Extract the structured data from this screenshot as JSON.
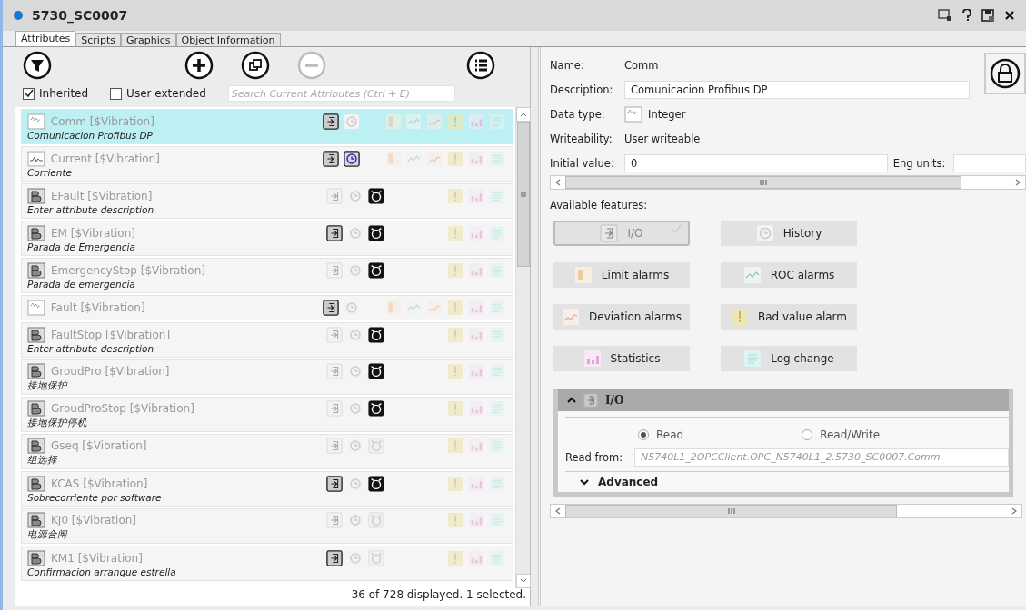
{
  "window": {
    "title": "5730_SC0007"
  },
  "tabs": [
    {
      "label": "Attributes",
      "selected": true
    },
    {
      "label": "Scripts",
      "selected": false
    },
    {
      "label": "Graphics",
      "selected": false
    },
    {
      "label": "Object Information",
      "selected": false
    }
  ],
  "filters": [
    {
      "label": "Inherited",
      "checked": true
    },
    {
      "label": "User extended",
      "checked": false
    }
  ],
  "search": {
    "placeholder": "Search Current Attributes (Ctrl + E)"
  },
  "attributes": [
    {
      "name": "Comm [$Vibration]",
      "description": "Comunicacion Profibus DP",
      "kind": "integer",
      "io": true,
      "history": false,
      "selected": true
    },
    {
      "name": "Current [$Vibration]",
      "description": "Corriente",
      "kind": "float",
      "io": true,
      "history": true,
      "selected": false
    },
    {
      "name": "EFault [$Vibration]",
      "description": "Enter attribute description",
      "kind": "boolean",
      "io": false,
      "history": false,
      "alarm": true,
      "selected": false
    },
    {
      "name": "EM [$Vibration]",
      "description": "Parada de Emergencia",
      "kind": "boolean",
      "io": true,
      "history": false,
      "alarm": true,
      "selected": false
    },
    {
      "name": "EmergencyStop [$Vibration]",
      "description": "Parada de emergencia",
      "kind": "boolean",
      "io": false,
      "history": false,
      "alarm": true,
      "selected": false
    },
    {
      "name": "Fault [$Vibration]",
      "kind": "integer",
      "io": true,
      "history": false,
      "selected": false
    },
    {
      "name": "FaultStop [$Vibration]",
      "description": "Enter attribute description",
      "kind": "boolean",
      "io": false,
      "history": false,
      "alarm": true,
      "selected": false
    },
    {
      "name": "GroudPro [$Vibration]",
      "description": "接地保护",
      "kind": "boolean",
      "io": false,
      "history": false,
      "alarm": true,
      "selected": false
    },
    {
      "name": "GroudProStop [$Vibration]",
      "description": "接地保护停机",
      "kind": "boolean",
      "io": false,
      "history": false,
      "alarm": true,
      "selected": false
    },
    {
      "name": "Gseq [$Vibration]",
      "description": "组选择",
      "kind": "boolean",
      "io": false,
      "history": false,
      "alarm": false,
      "selected": false
    },
    {
      "name": "KCAS [$Vibration]",
      "description": "Sobrecorriente por software",
      "kind": "boolean",
      "io": true,
      "history": false,
      "alarm": true,
      "selected": false
    },
    {
      "name": "KJ0 [$Vibration]",
      "description": "电源合闸",
      "kind": "boolean",
      "io": false,
      "history": false,
      "alarm": false,
      "selected": false
    },
    {
      "name": "KM1 [$Vibration]",
      "description": "Confirmacion arranque estrella",
      "kind": "boolean",
      "io": true,
      "history": false,
      "alarm": false,
      "selected": false
    }
  ],
  "status": "36 of 728 displayed. 1 selected.",
  "details": {
    "name_label": "Name:",
    "name": "Comm",
    "description_label": "Description:",
    "description": "Comunicacion Profibus DP",
    "data_type_label": "Data type:",
    "data_type": "Integer",
    "writeability_label": "Writeability:",
    "writeability": "User writeable",
    "initial_value_label": "Initial value:",
    "initial_value": "0",
    "eng_units_label": "Eng units:"
  },
  "features_title": "Available features:",
  "features": [
    {
      "label": "I/O",
      "kind": "io",
      "checked": true
    },
    {
      "label": "History",
      "kind": "history",
      "checked": false
    },
    {
      "label": "Limit alarms",
      "kind": "limit",
      "checked": false
    },
    {
      "label": "ROC alarms",
      "kind": "roc",
      "checked": false
    },
    {
      "label": "Deviation alarms",
      "kind": "deviation",
      "checked": false
    },
    {
      "label": "Bad value alarm",
      "kind": "badvalue",
      "checked": false
    },
    {
      "label": "Statistics",
      "kind": "stats",
      "checked": false
    },
    {
      "label": "Log change",
      "kind": "log",
      "checked": false
    }
  ],
  "io_section": {
    "title": "I/O",
    "expanded": true,
    "options": [
      {
        "label": "Read",
        "selected": true
      },
      {
        "label": "Read/Write",
        "selected": false
      }
    ],
    "read_from_label": "Read from:",
    "read_from": "N5740L1_2OPCClient.OPC_N5740L1_2.5730_SC0007.Comm",
    "advanced": "Advanced"
  }
}
